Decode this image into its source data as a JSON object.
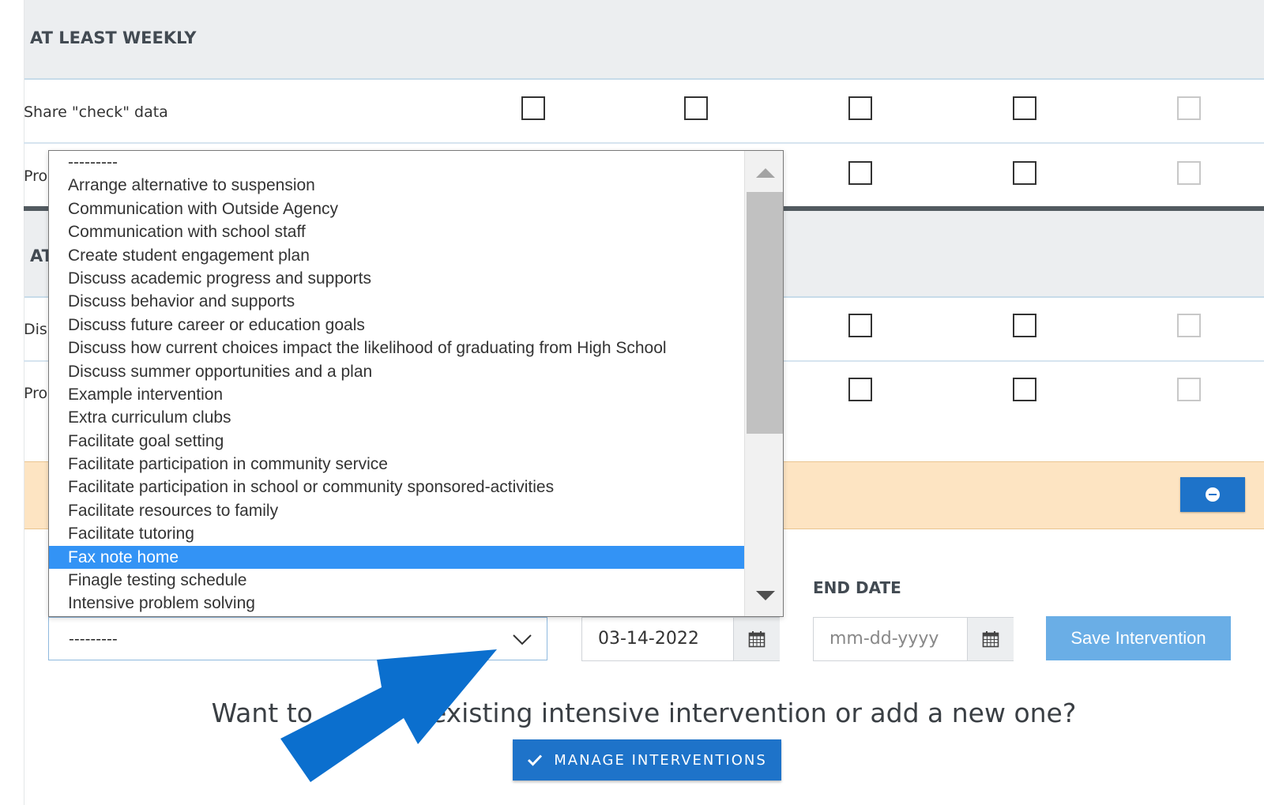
{
  "sections": [
    {
      "title": "AT LEAST WEEKLY"
    },
    {
      "title": "AT"
    }
  ],
  "rows": [
    {
      "label": "Share \"check\" data"
    },
    {
      "label": "Pro"
    },
    {
      "label": "Dis"
    },
    {
      "label": "Pro"
    }
  ],
  "dropdown": {
    "options": [
      "---------",
      "Arrange alternative to suspension",
      "Communication with Outside Agency",
      "Communication with school staff",
      "Create student engagement plan",
      "Discuss academic progress and supports",
      "Discuss behavior and supports",
      "Discuss future career or education goals",
      "Discuss how current choices impact the likelihood of graduating from High School",
      "Discuss summer opportunities and a plan",
      "Example intervention",
      "Extra curriculum clubs",
      "Facilitate goal setting",
      "Facilitate participation in community service",
      "Facilitate participation in school or community sponsored-activities",
      "Facilitate resources to family",
      "Facilitate tutoring",
      "Fax note home",
      "Finagle testing schedule",
      "Intensive problem solving"
    ],
    "highlighted": "Fax note home"
  },
  "form": {
    "select_value": "---------",
    "start_date_value": "03-14-2022",
    "end_date_label": "END DATE",
    "end_date_placeholder": "mm-dd-yyyy",
    "save_label": "Save Intervention"
  },
  "prompt": {
    "part1": "Want to",
    "part2": "existing intensive intervention or add a new one?"
  },
  "manage_button": {
    "label": "MANAGE INTERVENTIONS"
  },
  "colors": {
    "primary": "#1e73c9",
    "highlight": "#3393f5",
    "warning_bar": "#fde4c2",
    "save_button": "#6aaee6"
  }
}
